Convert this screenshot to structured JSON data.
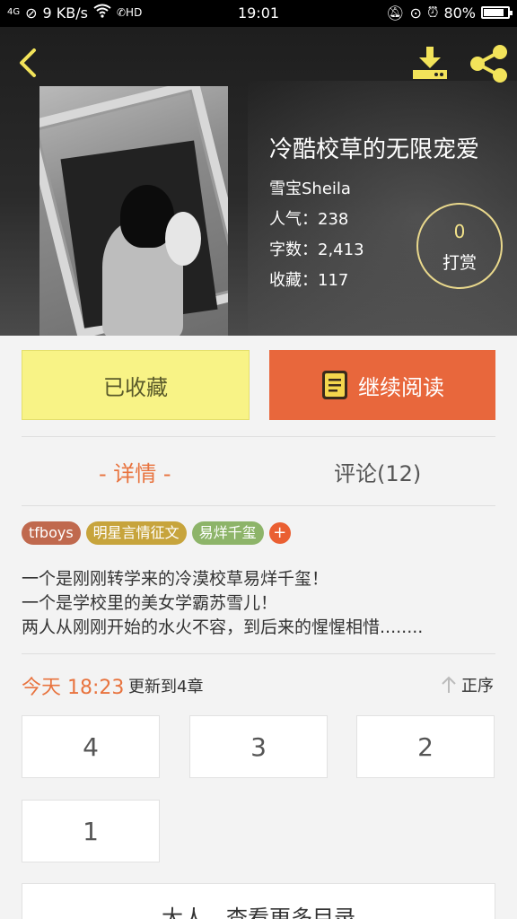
{
  "status_bar": {
    "network": "4G",
    "speed": "9 KB/s",
    "time": "19:01",
    "battery": "80%",
    "battery_level": 0.8
  },
  "book": {
    "title": "冷酷校草的无限宠爱",
    "author": "雪宝Sheila",
    "popularity": "人气：238",
    "word_count": "字数：2,413",
    "favorites": "收藏：117"
  },
  "tip": {
    "count": "0",
    "label": "打赏"
  },
  "actions": {
    "favorited_label": "已收藏",
    "continue_label": "继续阅读"
  },
  "tabs": {
    "details": "- 详情 -",
    "comments": "评论(12)"
  },
  "tags": [
    {
      "label": "tfboys",
      "color": "#c0694e"
    },
    {
      "label": "明星言情征文",
      "color": "#c7a43c"
    },
    {
      "label": "易烊千玺",
      "color": "#8db469"
    }
  ],
  "tag_more": "+",
  "description": [
    "一个是刚刚转学来的冷漠校草易烊千玺！",
    "一个是学校里的美女学霸苏雪儿！",
    "两人从刚刚开始的水火不容，到后来的惺惺相惜........"
  ],
  "update": {
    "date": "今天 18:23",
    "text": "更新到4章",
    "sort_label": "正序"
  },
  "chapters": [
    "4",
    "3",
    "2",
    "1"
  ],
  "more_catalog": "大人，查看更多目录",
  "colors": {
    "accent": "#e8733e",
    "favorite_bg": "#f8f386",
    "read_bg": "#e8673c",
    "icon_yellow": "#f2e35a"
  }
}
